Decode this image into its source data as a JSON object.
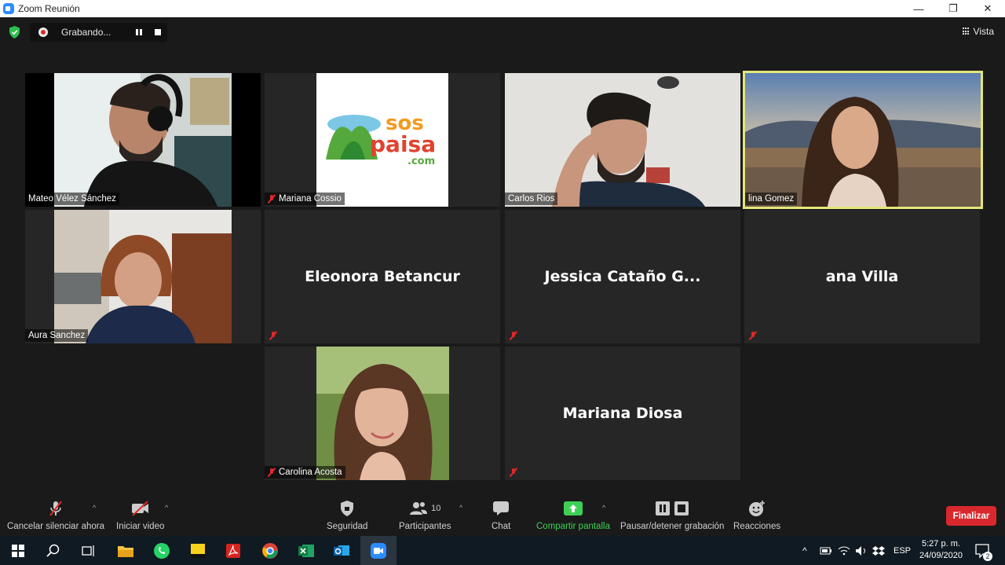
{
  "window": {
    "title": "Zoom Reunión",
    "minimize": "—",
    "restore": "❐",
    "close": "✕"
  },
  "topbar": {
    "recording_label": "Grabando...",
    "view_label": "Vista"
  },
  "participants": [
    {
      "name": "Mateo Vélez Sánchez",
      "muted": false,
      "video": true
    },
    {
      "name": "Mariana Cossio",
      "muted": true,
      "video": true
    },
    {
      "name": "Carlos Rios",
      "muted": false,
      "video": true
    },
    {
      "name": "lina Gomez",
      "muted": false,
      "video": true,
      "active_speaker": true
    },
    {
      "name": "Aura Sanchez",
      "muted": false,
      "video": true
    },
    {
      "name": "Eleonora Betancur",
      "muted": true,
      "video": false
    },
    {
      "name": "Jessica Cataño G...",
      "muted": true,
      "video": false
    },
    {
      "name": "ana Villa",
      "muted": true,
      "video": false
    },
    {
      "name": "Carolina Acosta",
      "muted": true,
      "video": true
    },
    {
      "name": "Mariana Diosa",
      "muted": true,
      "video": false
    }
  ],
  "logo": {
    "line1": "sos",
    "line2": "paisa",
    "line3": ".com"
  },
  "toolbar": {
    "mute_label": "Cancelar silenciar ahora",
    "video_label": "Iniciar video",
    "security_label": "Seguridad",
    "participants_label": "Participantes",
    "participants_count": "10",
    "chat_label": "Chat",
    "share_label": "Compartir pantalla",
    "record_label": "Pausar/detener grabación",
    "reactions_label": "Reacciones",
    "end_label": "Finalizar"
  },
  "taskbar": {
    "apps": [
      "windows-start",
      "search",
      "task-view",
      "file-explorer",
      "whatsapp",
      "sticky-notes",
      "acrobat",
      "chrome",
      "excel",
      "outlook",
      "zoom"
    ],
    "language": "ESP",
    "time": "5:27 p. m.",
    "date": "24/09/2020",
    "notifications": "2"
  },
  "colors": {
    "accent_green": "#3ecf55",
    "end_red": "#d9282d",
    "active_border": "#e3e67a",
    "zoom_blue": "#2d8cff"
  }
}
